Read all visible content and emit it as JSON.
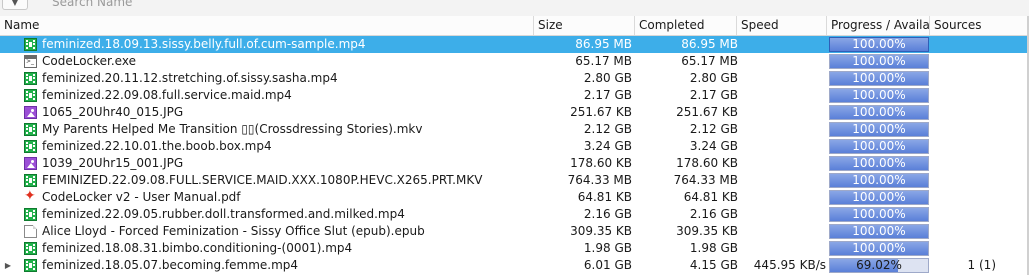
{
  "search": {
    "placeholder": "Search Name"
  },
  "header": {
    "name": "Name",
    "size": "Size",
    "completed": "Completed",
    "speed": "Speed",
    "progress": "Progress / Availab",
    "sources": "Sources"
  },
  "rows": [
    {
      "name": "feminized.18.09.13.sissy.belly.full.of.cum-sample.mp4",
      "icon": "video-file-icon",
      "size": "86.95 MB",
      "completed": "86.95 MB",
      "speed": "",
      "progress": 1.0,
      "progress_label": "100.00%",
      "sources": "",
      "selected": true
    },
    {
      "name": "CodeLocker.exe",
      "icon": "executable-file-icon",
      "size": "65.17 MB",
      "completed": "65.17 MB",
      "speed": "",
      "progress": 1.0,
      "progress_label": "100.00%",
      "sources": ""
    },
    {
      "name": "feminized.20.11.12.stretching.of.sissy.sasha.mp4",
      "icon": "video-file-icon",
      "size": "2.80 GB",
      "completed": "2.80 GB",
      "speed": "",
      "progress": 1.0,
      "progress_label": "100.00%",
      "sources": ""
    },
    {
      "name": "feminized.22.09.08.full.service.maid.mp4",
      "icon": "video-file-icon",
      "size": "2.17 GB",
      "completed": "2.17 GB",
      "speed": "",
      "progress": 1.0,
      "progress_label": "100.00%",
      "sources": ""
    },
    {
      "name": "1065_20Uhr40_015.JPG",
      "icon": "image-file-icon",
      "size": "251.67 KB",
      "completed": "251.67 KB",
      "speed": "",
      "progress": 1.0,
      "progress_label": "100.00%",
      "sources": ""
    },
    {
      "name": "My Parents Helped Me Transition ▯▯(Crossdressing Stories).mkv",
      "icon": "video-file-icon",
      "size": "2.12 GB",
      "completed": "2.12 GB",
      "speed": "",
      "progress": 1.0,
      "progress_label": "100.00%",
      "sources": ""
    },
    {
      "name": "feminized.22.10.01.the.boob.box.mp4",
      "icon": "video-file-icon",
      "size": "3.24 GB",
      "completed": "3.24 GB",
      "speed": "",
      "progress": 1.0,
      "progress_label": "100.00%",
      "sources": ""
    },
    {
      "name": "1039_20Uhr15_001.JPG",
      "icon": "image-file-icon",
      "size": "178.60 KB",
      "completed": "178.60 KB",
      "speed": "",
      "progress": 1.0,
      "progress_label": "100.00%",
      "sources": ""
    },
    {
      "name": "FEMINIZED.22.09.08.FULL.SERVICE.MAID.XXX.1080P.HEVC.X265.PRT.MKV",
      "icon": "video-file-icon",
      "size": "764.33 MB",
      "completed": "764.33 MB",
      "speed": "",
      "progress": 1.0,
      "progress_label": "100.00%",
      "sources": ""
    },
    {
      "name": "CodeLocker v2 - User Manual.pdf",
      "icon": "pdf-file-icon",
      "size": "64.81 KB",
      "completed": "64.81 KB",
      "speed": "",
      "progress": 1.0,
      "progress_label": "100.00%",
      "sources": ""
    },
    {
      "name": "feminized.22.09.05.rubber.doll.transformed.and.milked.mp4",
      "icon": "video-file-icon",
      "size": "2.16 GB",
      "completed": "2.16 GB",
      "speed": "",
      "progress": 1.0,
      "progress_label": "100.00%",
      "sources": ""
    },
    {
      "name": "Alice Lloyd - Forced Feminization - Sissy Office Slut (epub).epub",
      "icon": "document-file-icon",
      "size": "309.35 KB",
      "completed": "309.35 KB",
      "speed": "",
      "progress": 1.0,
      "progress_label": "100.00%",
      "sources": ""
    },
    {
      "name": "feminized.18.08.31.bimbo.conditioning-(0001).mp4",
      "icon": "video-file-icon",
      "size": "1.98 GB",
      "completed": "1.98 GB",
      "speed": "",
      "progress": 1.0,
      "progress_label": "100.00%",
      "sources": ""
    },
    {
      "name": "feminized.18.05.07.becoming.femme.mp4",
      "icon": "video-file-icon",
      "size": "6.01 GB",
      "completed": "4.15 GB",
      "speed": "445.95 KB/s",
      "progress": 0.6902,
      "progress_label": "69.02%",
      "sources": "1 (1)",
      "expandable": true
    }
  ]
}
